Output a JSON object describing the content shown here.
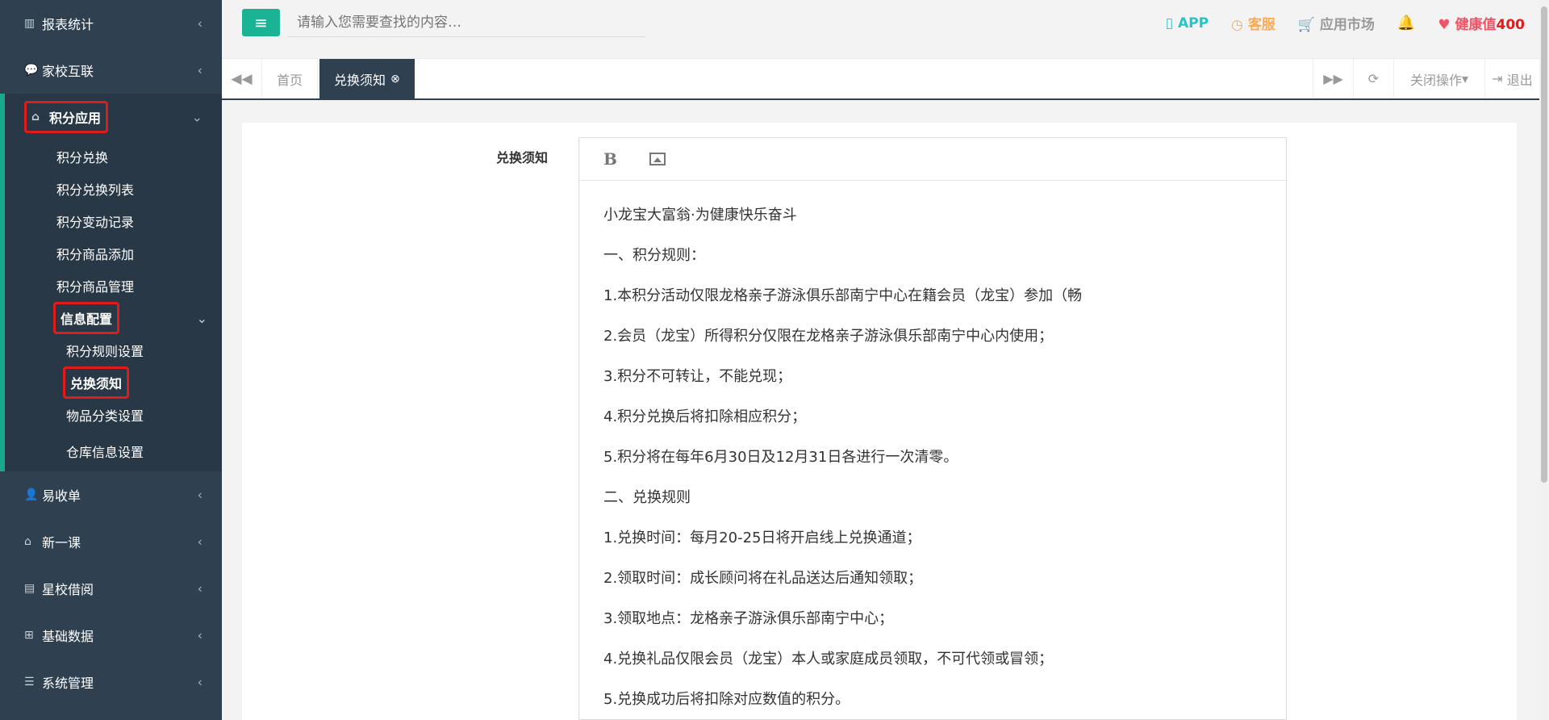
{
  "sidebar": {
    "menu_top": [
      {
        "label": "报表统计",
        "icon": "bar-chart-icon"
      },
      {
        "label": "家校互联",
        "icon": "chat-icon"
      }
    ],
    "active": {
      "label": "积分应用",
      "icon": "inbox-icon",
      "items": [
        "积分兑换",
        "积分兑换列表",
        "积分变动记录",
        "积分商品添加",
        "积分商品管理"
      ],
      "sub_group": {
        "label": "信息配置",
        "items": [
          "积分规则设置",
          "兑换须知",
          "物品分类设置",
          "仓库信息设置"
        ],
        "selected": "兑换须知"
      }
    },
    "menu_bottom": [
      {
        "label": "易收单",
        "icon": "user-add-icon"
      },
      {
        "label": "新一课",
        "icon": "inbox-icon"
      },
      {
        "label": "星校借阅",
        "icon": "book-icon"
      },
      {
        "label": "基础数据",
        "icon": "sitemap-icon"
      },
      {
        "label": "系统管理",
        "icon": "list-icon"
      }
    ]
  },
  "topbar": {
    "search_placeholder": "请输入您需要查找的内容…",
    "app_label": "APP",
    "kf_label": "客服",
    "market_label": "应用市场",
    "health_label": "健康值",
    "health_value": "400"
  },
  "tabs": {
    "home": "首页",
    "active": "兑换须知",
    "close_ops": "关闭操作",
    "logout": "退出"
  },
  "form": {
    "label": "兑换须知",
    "content": [
      "小龙宝大富翁·为健康快乐奋斗",
      "一、积分规则：",
      "1.本积分活动仅限龙格亲子游泳俱乐部南宁中心在籍会员（龙宝）参加（畅",
      "2.会员（龙宝）所得积分仅限在龙格亲子游泳俱乐部南宁中心内使用；",
      "3.积分不可转让，不能兑现；",
      "4.积分兑换后将扣除相应积分；",
      "5.积分将在每年6月30日及12月31日各进行一次清零。",
      "二、兑换规则",
      "1.兑换时间：每月20-25日将开启线上兑换通道；",
      "2.领取时间：成长顾问将在礼品送达后通知领取；",
      "3.领取地点：龙格亲子游泳俱乐部南宁中心；",
      "4.兑换礼品仅限会员（龙宝）本人或家庭成员领取，不可代领或冒领；",
      "5.兑换成功后将扣除对应数值的积分。"
    ]
  },
  "colors": {
    "sidebar_bg": "#2f4050",
    "accent": "#1ab394",
    "highlight_box": "#e01b1b"
  }
}
